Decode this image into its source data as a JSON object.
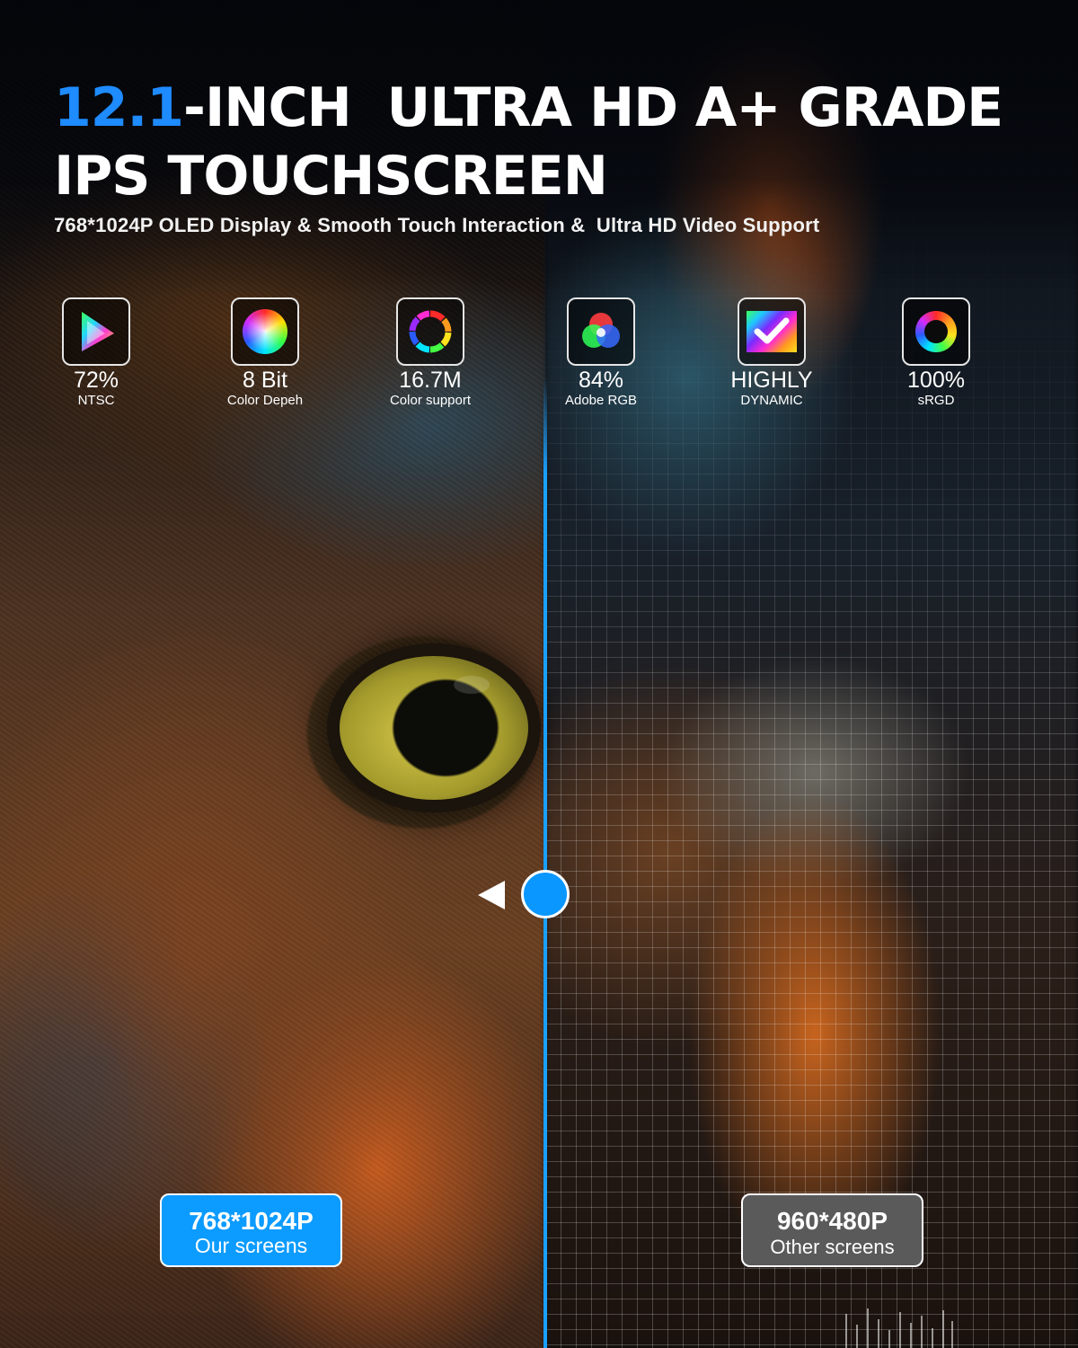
{
  "headline": {
    "accent": "12.1",
    "line1_rest": "-INCH  ULTRA HD A+ GRADE",
    "line2": "IPS TOUCHSCREEN"
  },
  "subtitle": "768*1024P OLED Display & Smooth Touch Interaction &  Ultra HD Video Support",
  "features": [
    {
      "icon": "color-gamut-triangle-icon",
      "value": "72%",
      "label": "NTSC"
    },
    {
      "icon": "color-wheel-icon",
      "value": "8 Bit",
      "label": "Color Depeh"
    },
    {
      "icon": "color-ring-segments-icon",
      "value": "16.7M",
      "label": "Color support"
    },
    {
      "icon": "rgb-circles-icon",
      "value": "84%",
      "label": "Adobe RGB"
    },
    {
      "icon": "checkmark-spectrum-icon",
      "value": "HIGHLY",
      "label": "DYNAMIC"
    },
    {
      "icon": "rainbow-ring-icon",
      "value": "100%",
      "label": "sRGD"
    }
  ],
  "comparison": {
    "ours": {
      "resolution": "768*1024P",
      "label": "Our screens"
    },
    "others": {
      "resolution": "960*480P",
      "label": "Other screens"
    }
  },
  "colors": {
    "accent": "#1e8bff",
    "divider": "#1aa0ff",
    "ours_tag": "#0c9bff",
    "others_tag": "#5a5a5a"
  }
}
